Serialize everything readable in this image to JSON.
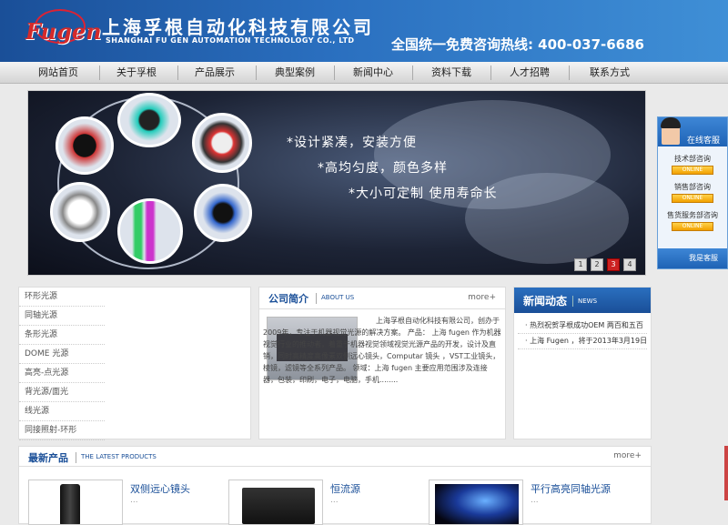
{
  "header": {
    "logo_text": "Fugen",
    "title_cn": "上海孚根自动化科技有限公司",
    "title_en": "SHANGHAI FU GEN AUTOMATION TECHNOLOGY CO., LTD",
    "hotline": "全国统一免费咨询热线: 400-037-6686"
  },
  "nav": {
    "items": [
      {
        "label": "网站首页"
      },
      {
        "label": "关于孚根"
      },
      {
        "label": "产品展示"
      },
      {
        "label": "典型案例"
      },
      {
        "label": "新闻中心"
      },
      {
        "label": "资料下载"
      },
      {
        "label": "人才招聘"
      },
      {
        "label": "联系方式"
      }
    ]
  },
  "banner": {
    "slogans": [
      "*设计紧凑，安装方便",
      "*高均匀度，颜色多样",
      "*大小可定制 使用寿命长"
    ],
    "pages": [
      "1",
      "2",
      "3",
      "4"
    ],
    "active_page": "3"
  },
  "sidemenu": {
    "items": [
      "环形光源",
      "同轴光源",
      "条形光源",
      "DOME 光源",
      "高亮-点光源",
      "背光源/面光",
      "线光源",
      "同接照射-环形"
    ]
  },
  "company": {
    "title": "公司简介",
    "title_en": "ABOUT US",
    "more": "more+",
    "text": "上海孚根自动化科技有限公司，创办于2009年，专注于机器视觉光源的解决方案。 产品： 上海 fugen 作为机器视觉行业的推动者，着重于机器视觉领域视觉光源产品的开发，设计及直销，同时高精度高像素双侧远心镜头，Computar 镜头 ，VST工业镜头，棱镜，滤镜等全系列产品。 领域：上海 fugen 主要应用范围涉及连接器，包装，印刷，电子，电脑，手机........"
  },
  "news": {
    "title": "新闻动态",
    "title_en": "NEWS",
    "items": [
      "· 热烈祝贺孚根成功OEM 两百和五百",
      "· 上海 Fugen ，将于2013年3月19日"
    ]
  },
  "latest": {
    "title": "最新产品",
    "title_en": "THE LATEST PRODUCTS",
    "more": "more+",
    "products": [
      {
        "name": "双侧远心镜头",
        "dots": "..."
      },
      {
        "name": "恒流源",
        "dots": "..."
      },
      {
        "name": "平行高亮同轴光源",
        "dots": "..."
      }
    ]
  },
  "kefu": {
    "title": "在线客服",
    "lines": [
      "技术部咨询",
      "销售部咨询",
      "售货服务部咨询"
    ],
    "qq_label": "ONLINE",
    "bottom": "我是客服"
  }
}
